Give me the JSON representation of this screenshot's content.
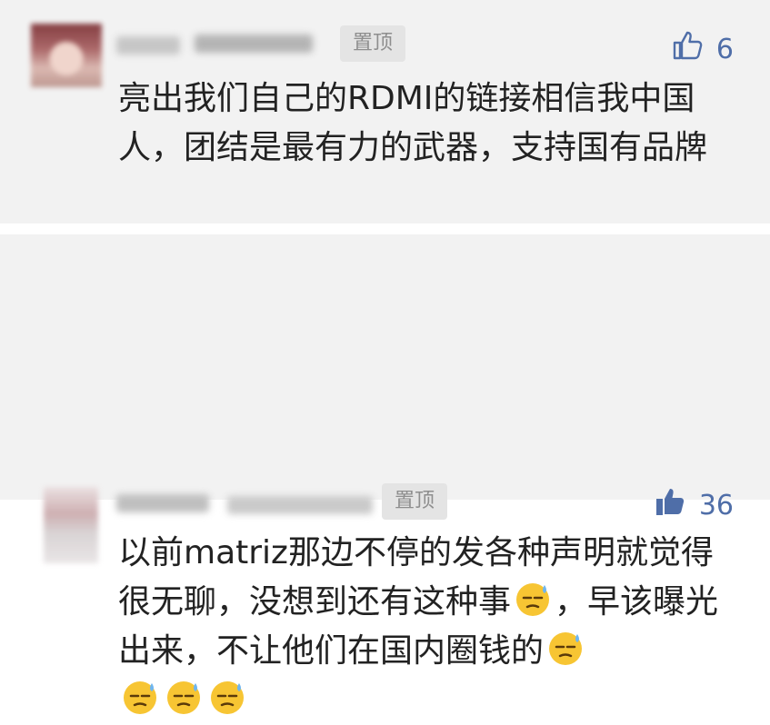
{
  "comments": [
    {
      "pin_label": "置顶",
      "likes": "6",
      "liked": false,
      "text": "亮出我们自己的RDMI的链接相信我中国人，团结是最有力的武器，支持国有品牌"
    },
    {
      "pin_label": "置顶",
      "likes": "36",
      "liked": true,
      "text_part1": "以前matriz那边不停的发各种声明就觉得很无聊，没想到还有这种事",
      "text_part2": "，早该曝光出来，不让他们在国内圈钱的",
      "emoji_name": "sweat-smile-emoji"
    }
  ],
  "colors": {
    "like_blue": "#4f6ea8",
    "text": "#222222",
    "pin_bg": "#e4e4e4",
    "card_bg": "#f2f2f2"
  }
}
